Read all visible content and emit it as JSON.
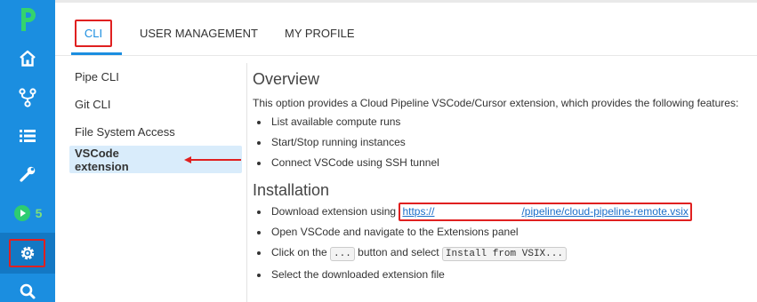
{
  "sidebar": {
    "runs_count": "5"
  },
  "tabs": [
    {
      "label": "CLI"
    },
    {
      "label": "USER MANAGEMENT"
    },
    {
      "label": "MY PROFILE"
    }
  ],
  "submenu": [
    {
      "label": "Pipe CLI"
    },
    {
      "label": "Git CLI"
    },
    {
      "label": "File System Access"
    },
    {
      "label": "VSCode extension"
    }
  ],
  "overview": {
    "title": "Overview",
    "intro": "This option provides a Cloud Pipeline VSCode/Cursor extension, which provides the following features:",
    "features": [
      "List available compute runs",
      "Start/Stop running instances",
      "Connect VSCode using SSH tunnel"
    ]
  },
  "installation": {
    "title": "Installation",
    "download_prefix": "Download extension using ",
    "link_start": "https://",
    "link_end": "/pipeline/cloud-pipeline-remote.vsix",
    "step2": "Open VSCode and navigate to the Extensions panel",
    "step3_prefix": "Click on the ",
    "step3_code1": "...",
    "step3_mid": " button and select ",
    "step3_code2": "Install from VSIX...",
    "step4": "Select the downloaded extension file"
  },
  "colors": {
    "rail_bg": "#1b8ee0",
    "accent": "#1b8ee0",
    "highlight_border": "#e02020",
    "active_bg": "#d9ecfb"
  }
}
